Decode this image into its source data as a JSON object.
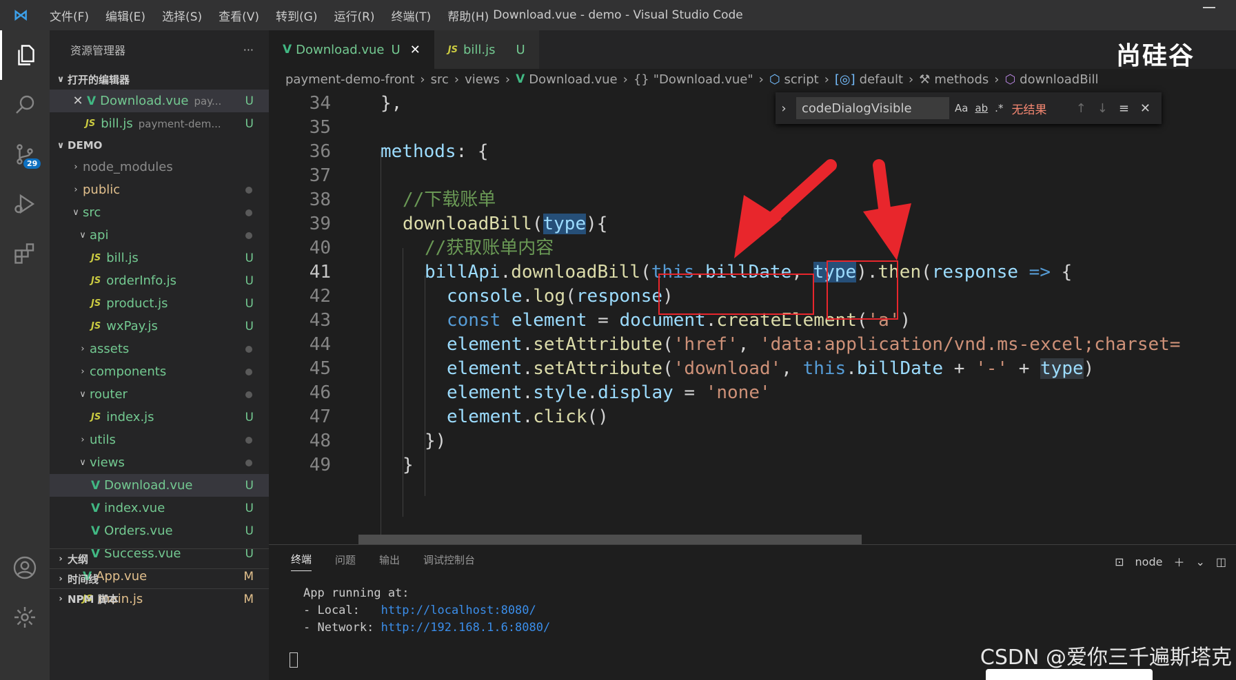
{
  "titlebar": {
    "menu": [
      "文件(F)",
      "编辑(E)",
      "选择(S)",
      "查看(V)",
      "转到(G)",
      "运行(R)",
      "终端(T)",
      "帮助(H)"
    ],
    "window_title": "Download.vue - demo - Visual Studio Code"
  },
  "activity": {
    "scm_badge": "29"
  },
  "sidebar": {
    "title": "资源管理器",
    "more": "···",
    "open_editors_label": "打开的编辑器",
    "open_editors": [
      {
        "name": "Download.vue",
        "path": "pay...",
        "status": "U"
      },
      {
        "name": "bill.js",
        "path": "payment-dem...",
        "status": "U"
      }
    ],
    "workspace_label": "DEMO",
    "tree": [
      {
        "name": "node_modules",
        "status": ""
      },
      {
        "name": "public",
        "status": ""
      },
      {
        "name": "src",
        "status": ""
      },
      {
        "name": "api",
        "status": ""
      },
      {
        "name": "bill.js",
        "status": "U"
      },
      {
        "name": "orderInfo.js",
        "status": "U"
      },
      {
        "name": "product.js",
        "status": "U"
      },
      {
        "name": "wxPay.js",
        "status": "U"
      },
      {
        "name": "assets",
        "status": ""
      },
      {
        "name": "components",
        "status": ""
      },
      {
        "name": "router",
        "status": ""
      },
      {
        "name": "index.js",
        "status": "U"
      },
      {
        "name": "utils",
        "status": ""
      },
      {
        "name": "views",
        "status": ""
      },
      {
        "name": "Download.vue",
        "status": "U"
      },
      {
        "name": "index.vue",
        "status": "U"
      },
      {
        "name": "Orders.vue",
        "status": "U"
      },
      {
        "name": "Success.vue",
        "status": "U"
      },
      {
        "name": "App.vue",
        "status": "M"
      },
      {
        "name": "main.js",
        "status": "M"
      }
    ],
    "outline_label": "大纲",
    "timeline_label": "时间线",
    "npm_label": "NPM 脚本"
  },
  "tabs": [
    {
      "label": "Download.vue",
      "status": "U"
    },
    {
      "label": "bill.js",
      "status": "U"
    }
  ],
  "brand": "尚硅谷",
  "breadcrumb": [
    "payment-demo-front",
    "src",
    "views",
    "Download.vue",
    "\"Download.vue\"",
    "script",
    "default",
    "methods",
    "downloadBill"
  ],
  "find": {
    "query": "codeDialogVisible",
    "opt_case": "Aa",
    "opt_word": "ab",
    "opt_regex": ".*",
    "result": "无结果"
  },
  "editor": {
    "line_numbers": [
      "34",
      "35",
      "36",
      "37",
      "38",
      "39",
      "40",
      "41",
      "42",
      "43",
      "44",
      "45",
      "46",
      "47",
      "48",
      "49"
    ],
    "lines": {
      "l34": "},",
      "l36a": "methods",
      "l36b": ": {",
      "l38": "//下载账单",
      "l39a": "downloadBill",
      "l39b": "(",
      "l39c": "type",
      "l39d": "){",
      "l40": "//获取账单内容",
      "l41a": "billApi",
      "l41b": ".",
      "l41c": "downloadBill",
      "l41d": "(",
      "l41e": "this",
      "l41f": ".",
      "l41g": "billDate",
      "l41h": ", ",
      "l41i": "type",
      "l41j": ").",
      "l41k": "then",
      "l41l": "(",
      "l41m": "response",
      "l41n": " => ",
      "l41o": "{",
      "l42a": "console",
      "l42b": ".",
      "l42c": "log",
      "l42d": "(",
      "l42e": "response",
      "l42f": ")",
      "l43a": "const",
      "l43b": " element",
      "l43c": " = ",
      "l43d": "document",
      "l43e": ".",
      "l43f": "createElement",
      "l43g": "(",
      "l43h": "'a'",
      "l43i": ")",
      "l44a": "element",
      "l44b": ".",
      "l44c": "setAttribute",
      "l44d": "(",
      "l44e": "'href'",
      "l44f": ", ",
      "l44g": "'data:application/vnd.ms-excel;charset=",
      "l45a": "element",
      "l45b": ".",
      "l45c": "setAttribute",
      "l45d": "(",
      "l45e": "'download'",
      "l45f": ", ",
      "l45g": "this",
      "l45h": ".",
      "l45i": "billDate",
      "l45j": " + ",
      "l45k": "'-'",
      "l45l": " + ",
      "l45m": "type",
      "l45n": ")",
      "l46a": "element",
      "l46b": ".",
      "l46c": "style",
      "l46d": ".",
      "l46e": "display",
      "l46f": " = ",
      "l46g": "'none'",
      "l47a": "element",
      "l47b": ".",
      "l47c": "click",
      "l47d": "()",
      "l48": "})",
      "l49": "}"
    }
  },
  "panel": {
    "tabs": [
      "终端",
      "问题",
      "输出",
      "调试控制台"
    ],
    "shell": "node",
    "terminal": {
      "line1": "App running at:",
      "local_label": "- Local:   ",
      "local_url": "http://localhost:8080/",
      "network_label": "- Network: ",
      "network_url": "http://192.168.1.6:8080/"
    }
  },
  "watermark": "CSDN @爱你三千遍斯塔克",
  "colors": {
    "accent_blue": "#0e70c0",
    "untracked_green": "#73c991",
    "modified_yellow": "#e2c08d",
    "annotation_red": "#e8262c"
  }
}
